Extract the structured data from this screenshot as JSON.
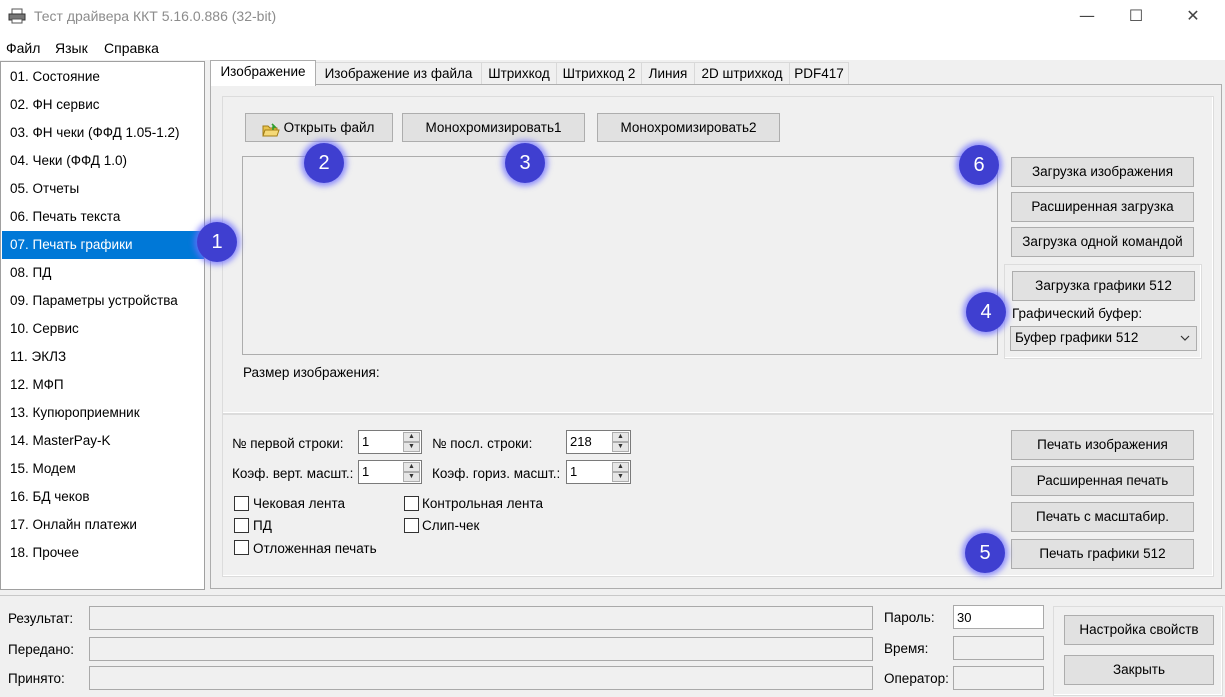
{
  "window": {
    "title": "Тест драйвера ККТ 5.16.0.886 (32-bit)",
    "minimize": "—",
    "maximize": "☐",
    "close": "✕"
  },
  "menu": [
    "Файл",
    "Язык",
    "Справка"
  ],
  "nav": [
    "01. Состояние",
    "02. ФН сервис",
    "03. ФН чеки (ФФД 1.05-1.2)",
    "04. Чеки (ФФД 1.0)",
    "05. Отчеты",
    "06. Печать текста",
    "07. Печать графики",
    "08. ПД",
    "09. Параметры устройства",
    "10. Сервис",
    "11. ЭКЛЗ",
    "12. МФП",
    "13. Купюроприемник",
    "14. MasterPay-K",
    "15. Модем",
    "16. БД чеков",
    "17. Онлайн платежи",
    "18. Прочее"
  ],
  "nav_selected": "07. Печать графики",
  "tabs": [
    "Изображение",
    "Изображение из файла",
    "Штрихкод",
    "Штрихкод 2",
    "Линия",
    "2D штрихкод",
    "PDF417"
  ],
  "image_tab": {
    "open_file": "Открыть файл",
    "mono1": "Монохромизировать1",
    "mono2": "Монохромизировать2",
    "load_image": "Загрузка изображения",
    "extended_load": "Расширенная загрузка",
    "single_cmd_load": "Загрузка одной командой",
    "load_graphics_512": "Загрузка графики 512",
    "graphics_buffer_label": "Графический буфер:",
    "graphics_buffer_value": "Буфер графики 512",
    "image_size_label": "Размер изображения:",
    "first_line_label": "№ первой строки:",
    "first_line_value": "1",
    "last_line_label": "№ посл. строки:",
    "last_line_value": "218",
    "vscale_label": "Коэф. верт. масшт.:",
    "vscale_value": "1",
    "hscale_label": "Коэф. гориз. масшт.:",
    "hscale_value": "1",
    "chk_receipt_tape": "Чековая лента",
    "chk_control_tape": "Контрольная лента",
    "chk_pd": "ПД",
    "chk_slip": "Слип-чек",
    "chk_deferred": "Отложенная печать",
    "print_image": "Печать изображения",
    "extended_print": "Расширенная печать",
    "scaled_print": "Печать с масштабир.",
    "print_graphics_512": "Печать графики 512"
  },
  "badges": [
    "1",
    "2",
    "3",
    "4",
    "5",
    "6"
  ],
  "status": {
    "result_label": "Результат:",
    "sent_label": "Передано:",
    "received_label": "Принято:",
    "password_label": "Пароль:",
    "password_value": "30",
    "time_label": "Время:",
    "operator_label": "Оператор:",
    "settings_button": "Настройка свойств",
    "close_button": "Закрыть"
  }
}
